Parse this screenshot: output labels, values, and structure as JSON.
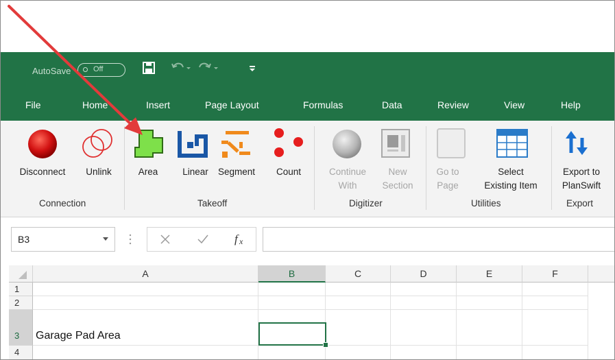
{
  "quick_access": {
    "autosave_label": "AutoSave",
    "autosave_state": "Off",
    "save_icon": "save-icon",
    "undo_icon": "undo-icon",
    "redo_icon": "redo-icon",
    "customize_icon": "customize-qat-icon"
  },
  "tabs": [
    "File",
    "Home",
    "Insert",
    "Page Layout",
    "Formulas",
    "Data",
    "Review",
    "View",
    "Help"
  ],
  "ribbon": {
    "groups": [
      {
        "label": "Connection",
        "buttons": [
          {
            "line1": "Disconnect",
            "line2": "",
            "icon": "disconnect-icon"
          },
          {
            "line1": "Unlink",
            "line2": "",
            "icon": "unlink-icon"
          }
        ]
      },
      {
        "label": "Takeoff",
        "buttons": [
          {
            "line1": "Area",
            "line2": "",
            "icon": "area-icon"
          },
          {
            "line1": "Linear",
            "line2": "",
            "icon": "linear-icon"
          },
          {
            "line1": "Segment",
            "line2": "",
            "icon": "segment-icon"
          },
          {
            "line1": "Count",
            "line2": "",
            "icon": "count-icon"
          }
        ]
      },
      {
        "label": "Digitizer",
        "buttons": [
          {
            "line1": "Continue",
            "line2": "With",
            "icon": "continue-with-icon",
            "disabled": true
          },
          {
            "line1": "New",
            "line2": "Section",
            "icon": "new-section-icon",
            "disabled": true
          }
        ]
      },
      {
        "label": "Utilities",
        "buttons": [
          {
            "line1": "Go to",
            "line2": "Page",
            "icon": "go-to-page-icon",
            "disabled": true
          },
          {
            "line1": "Select",
            "line2": "Existing Item",
            "icon": "select-existing-item-icon"
          }
        ]
      },
      {
        "label": "Export",
        "buttons": [
          {
            "line1": "Export to",
            "line2": "PlanSwift",
            "icon": "export-icon"
          }
        ]
      }
    ]
  },
  "formula_bar": {
    "name_box": "B3",
    "formula": ""
  },
  "sheet": {
    "columns": [
      "A",
      "B",
      "C",
      "D",
      "E",
      "F"
    ],
    "rows": [
      "1",
      "2",
      "3",
      "4"
    ],
    "selected_cell": "B3",
    "cells": {
      "A3": "Garage Pad Area"
    }
  },
  "colors": {
    "excel_green": "#217346",
    "ribbon_bg": "#f3f3f3",
    "arrow_red": "#e23b3b"
  }
}
